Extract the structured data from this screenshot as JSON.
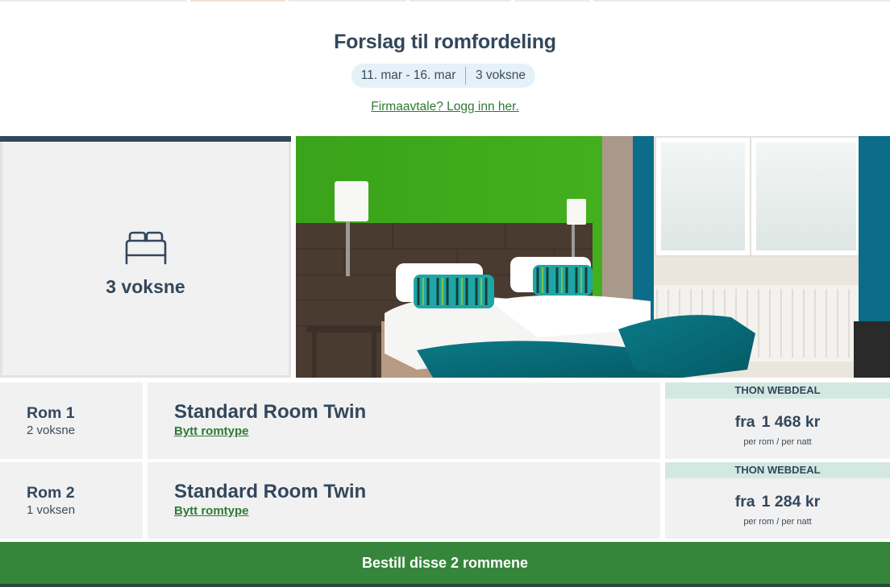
{
  "header": {
    "title": "Forslag til romfordeling",
    "dates": "11. mar - 16. mar",
    "guests": "3 voksne",
    "login_link": "Firmaavtale? Logg inn her."
  },
  "guest_card": {
    "icon": "bed-icon",
    "label": "3 voksne"
  },
  "rooms": [
    {
      "name": "Rom 1",
      "occupancy": "2 voksne",
      "type": "Standard Room Twin",
      "change_label": "Bytt romtype",
      "deal": "THON WEBDEAL",
      "from": "fra",
      "price": "1 468 kr",
      "per": "per rom / per natt"
    },
    {
      "name": "Rom 2",
      "occupancy": "1 voksen",
      "type": "Standard Room Twin",
      "change_label": "Bytt romtype",
      "deal": "THON WEBDEAL",
      "from": "fra",
      "price": "1 284 kr",
      "per": "per rom / per natt"
    }
  ],
  "book_button": "Bestill disse 2 rommene",
  "colors": {
    "primary": "#33475b",
    "link_green": "#2f7a35",
    "button_green": "#35863a",
    "deal_bg": "#d4e8e2",
    "card_bg": "#f1f1f1",
    "pill_bg": "#e5f1f8"
  }
}
